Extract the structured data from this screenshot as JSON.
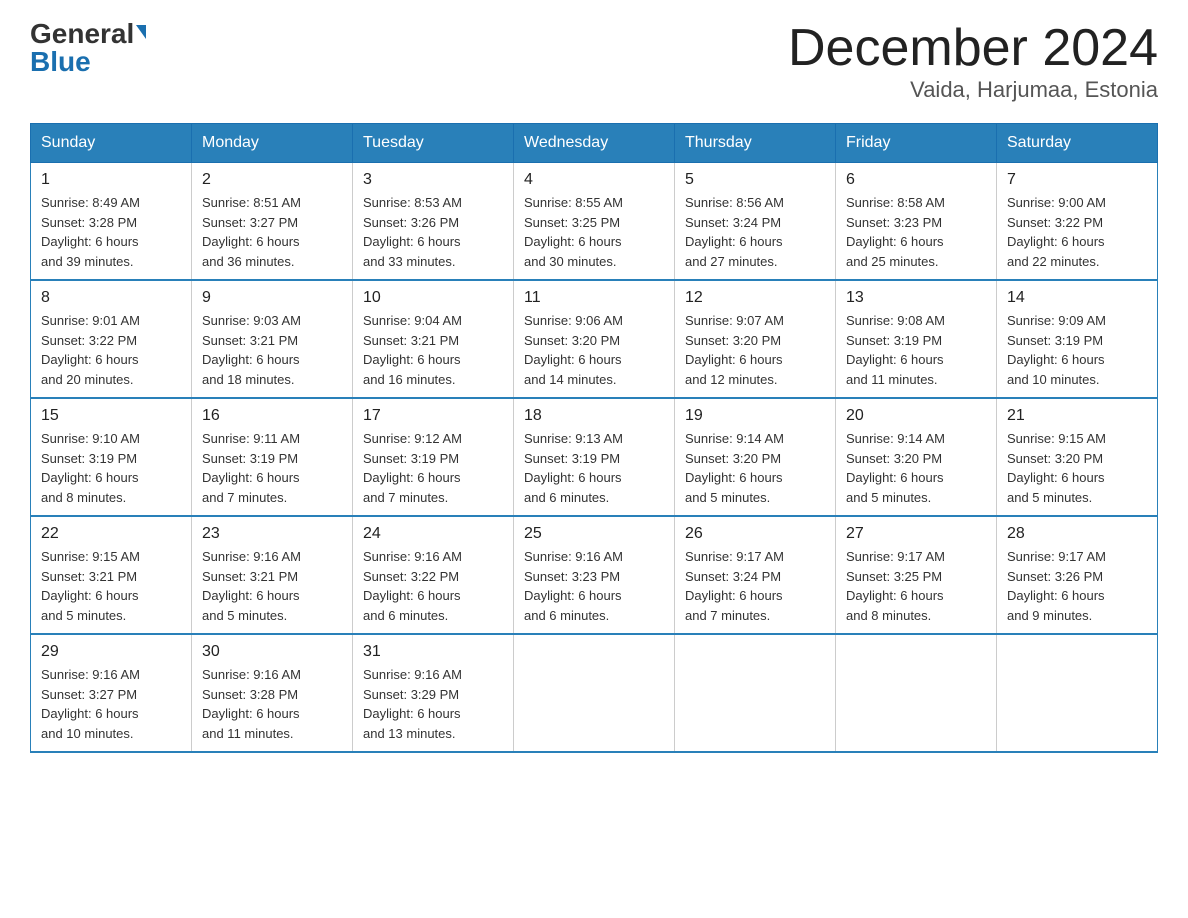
{
  "logo": {
    "general": "General",
    "blue": "Blue"
  },
  "title": "December 2024",
  "subtitle": "Vaida, Harjumaa, Estonia",
  "days_of_week": [
    "Sunday",
    "Monday",
    "Tuesday",
    "Wednesday",
    "Thursday",
    "Friday",
    "Saturday"
  ],
  "weeks": [
    [
      {
        "day": "1",
        "sunrise": "8:49 AM",
        "sunset": "3:28 PM",
        "daylight": "6 hours and 39 minutes."
      },
      {
        "day": "2",
        "sunrise": "8:51 AM",
        "sunset": "3:27 PM",
        "daylight": "6 hours and 36 minutes."
      },
      {
        "day": "3",
        "sunrise": "8:53 AM",
        "sunset": "3:26 PM",
        "daylight": "6 hours and 33 minutes."
      },
      {
        "day": "4",
        "sunrise": "8:55 AM",
        "sunset": "3:25 PM",
        "daylight": "6 hours and 30 minutes."
      },
      {
        "day": "5",
        "sunrise": "8:56 AM",
        "sunset": "3:24 PM",
        "daylight": "6 hours and 27 minutes."
      },
      {
        "day": "6",
        "sunrise": "8:58 AM",
        "sunset": "3:23 PM",
        "daylight": "6 hours and 25 minutes."
      },
      {
        "day": "7",
        "sunrise": "9:00 AM",
        "sunset": "3:22 PM",
        "daylight": "6 hours and 22 minutes."
      }
    ],
    [
      {
        "day": "8",
        "sunrise": "9:01 AM",
        "sunset": "3:22 PM",
        "daylight": "6 hours and 20 minutes."
      },
      {
        "day": "9",
        "sunrise": "9:03 AM",
        "sunset": "3:21 PM",
        "daylight": "6 hours and 18 minutes."
      },
      {
        "day": "10",
        "sunrise": "9:04 AM",
        "sunset": "3:21 PM",
        "daylight": "6 hours and 16 minutes."
      },
      {
        "day": "11",
        "sunrise": "9:06 AM",
        "sunset": "3:20 PM",
        "daylight": "6 hours and 14 minutes."
      },
      {
        "day": "12",
        "sunrise": "9:07 AM",
        "sunset": "3:20 PM",
        "daylight": "6 hours and 12 minutes."
      },
      {
        "day": "13",
        "sunrise": "9:08 AM",
        "sunset": "3:19 PM",
        "daylight": "6 hours and 11 minutes."
      },
      {
        "day": "14",
        "sunrise": "9:09 AM",
        "sunset": "3:19 PM",
        "daylight": "6 hours and 10 minutes."
      }
    ],
    [
      {
        "day": "15",
        "sunrise": "9:10 AM",
        "sunset": "3:19 PM",
        "daylight": "6 hours and 8 minutes."
      },
      {
        "day": "16",
        "sunrise": "9:11 AM",
        "sunset": "3:19 PM",
        "daylight": "6 hours and 7 minutes."
      },
      {
        "day": "17",
        "sunrise": "9:12 AM",
        "sunset": "3:19 PM",
        "daylight": "6 hours and 7 minutes."
      },
      {
        "day": "18",
        "sunrise": "9:13 AM",
        "sunset": "3:19 PM",
        "daylight": "6 hours and 6 minutes."
      },
      {
        "day": "19",
        "sunrise": "9:14 AM",
        "sunset": "3:20 PM",
        "daylight": "6 hours and 5 minutes."
      },
      {
        "day": "20",
        "sunrise": "9:14 AM",
        "sunset": "3:20 PM",
        "daylight": "6 hours and 5 minutes."
      },
      {
        "day": "21",
        "sunrise": "9:15 AM",
        "sunset": "3:20 PM",
        "daylight": "6 hours and 5 minutes."
      }
    ],
    [
      {
        "day": "22",
        "sunrise": "9:15 AM",
        "sunset": "3:21 PM",
        "daylight": "6 hours and 5 minutes."
      },
      {
        "day": "23",
        "sunrise": "9:16 AM",
        "sunset": "3:21 PM",
        "daylight": "6 hours and 5 minutes."
      },
      {
        "day": "24",
        "sunrise": "9:16 AM",
        "sunset": "3:22 PM",
        "daylight": "6 hours and 6 minutes."
      },
      {
        "day": "25",
        "sunrise": "9:16 AM",
        "sunset": "3:23 PM",
        "daylight": "6 hours and 6 minutes."
      },
      {
        "day": "26",
        "sunrise": "9:17 AM",
        "sunset": "3:24 PM",
        "daylight": "6 hours and 7 minutes."
      },
      {
        "day": "27",
        "sunrise": "9:17 AM",
        "sunset": "3:25 PM",
        "daylight": "6 hours and 8 minutes."
      },
      {
        "day": "28",
        "sunrise": "9:17 AM",
        "sunset": "3:26 PM",
        "daylight": "6 hours and 9 minutes."
      }
    ],
    [
      {
        "day": "29",
        "sunrise": "9:16 AM",
        "sunset": "3:27 PM",
        "daylight": "6 hours and 10 minutes."
      },
      {
        "day": "30",
        "sunrise": "9:16 AM",
        "sunset": "3:28 PM",
        "daylight": "6 hours and 11 minutes."
      },
      {
        "day": "31",
        "sunrise": "9:16 AM",
        "sunset": "3:29 PM",
        "daylight": "6 hours and 13 minutes."
      },
      null,
      null,
      null,
      null
    ]
  ],
  "labels": {
    "sunrise": "Sunrise:",
    "sunset": "Sunset:",
    "daylight": "Daylight:"
  }
}
